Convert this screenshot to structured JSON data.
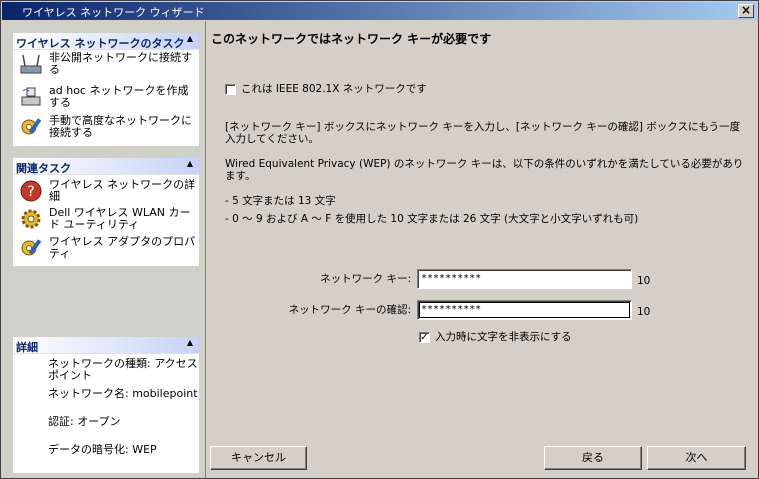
{
  "window": {
    "title": "ワイヤレス ネットワーク ウィザード",
    "close_glyph": "×"
  },
  "sidebar": {
    "network_tasks": {
      "header": "ワイヤレス ネットワークのタスク",
      "toggle": "▲",
      "items": [
        {
          "label": "非公開ネットワークに接続する",
          "icon": "wireless-router-icon"
        },
        {
          "label": "ad hoc ネットワークを作成する",
          "icon": "adhoc-computer-icon"
        },
        {
          "label": "手動で高度なネットワークに接続する",
          "icon": "advanced-settings-icon"
        }
      ]
    },
    "related_tasks": {
      "header": "関連タスク",
      "toggle": "▲",
      "items": [
        {
          "label": "ワイヤレス ネットワークの詳細",
          "icon": "help-icon"
        },
        {
          "label": "Dell ワイヤレス WLAN カード ユーティリティ",
          "icon": "gear-icon"
        },
        {
          "label": "ワイヤレス アダプタのプロパティ",
          "icon": "adapter-properties-icon"
        }
      ]
    },
    "details": {
      "header": "詳細",
      "toggle": "▲",
      "items": [
        "ネットワークの種類: アクセス ポイント",
        "ネットワーク名: mobilepoint",
        "認証: オープン",
        "データの暗号化: WEP"
      ]
    }
  },
  "main": {
    "heading": "このネットワークではネットワーク キーが必要です",
    "ieee_checkbox": {
      "label": "これは IEEE 802.1X ネットワークです",
      "checked": false
    },
    "instruction": "[ネットワーク キー] ボックスにネットワーク キーを入力し、[ネットワーク キーの確認] ボックスにもう一度入力してください。",
    "wep_intro": "Wired Equivalent Privacy (WEP) のネットワーク キーは、以下の条件のいずれかを満たしている必要があります。",
    "conditions": [
      "- 5 文字または 13 文字",
      "- 0 ～ 9 および A ～ F を使用した 10 文字または 26 文字 (大文字と小文字いずれも可)"
    ],
    "network_key": {
      "label": "ネットワーク キー:",
      "value": "**********",
      "count": "10"
    },
    "confirm_key": {
      "label": "ネットワーク キーの確認:",
      "value": "**********",
      "count": "10"
    },
    "hide_chars": {
      "label": "入力時に文字を非表示にする",
      "checked": true,
      "mark": "✓"
    }
  },
  "buttons": {
    "cancel": "キャンセル",
    "back": "戻る",
    "next": "次へ"
  }
}
